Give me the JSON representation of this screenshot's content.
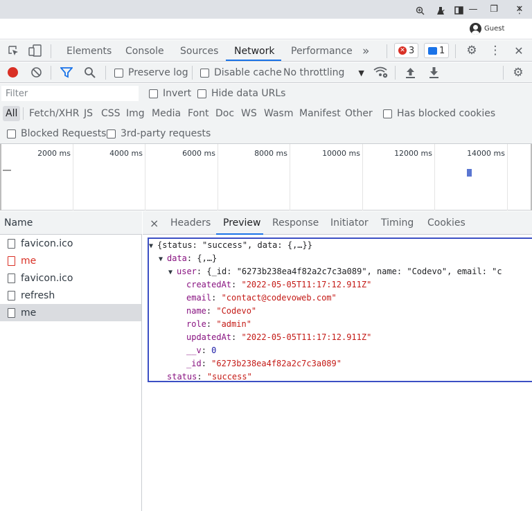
{
  "browser": {
    "profile_label": "Guest"
  },
  "devtools": {
    "tabs": [
      "Elements",
      "Console",
      "Sources",
      "Network",
      "Performance"
    ],
    "more_tabs": "»",
    "error_count": "3",
    "message_count": "1"
  },
  "network_toolbar": {
    "preserve_log": "Preserve log",
    "disable_cache": "Disable cache",
    "throttling": "No throttling"
  },
  "filter": {
    "placeholder": "Filter",
    "invert": "Invert",
    "hide_data_urls": "Hide data URLs",
    "types": [
      "All",
      "Fetch/XHR",
      "JS",
      "CSS",
      "Img",
      "Media",
      "Font",
      "Doc",
      "WS",
      "Wasm",
      "Manifest",
      "Other"
    ],
    "has_blocked_cookies": "Has blocked cookies",
    "blocked_requests": "Blocked Requests",
    "third_party": "3rd-party requests"
  },
  "timeline": {
    "ticks": [
      "2000 ms",
      "4000 ms",
      "6000 ms",
      "8000 ms",
      "10000 ms",
      "12000 ms",
      "14000 ms"
    ]
  },
  "requests": {
    "header": "Name",
    "rows": [
      {
        "name": "favicon.ico",
        "status": "ok"
      },
      {
        "name": "me",
        "status": "error"
      },
      {
        "name": "favicon.ico",
        "status": "ok"
      },
      {
        "name": "refresh",
        "status": "ok"
      },
      {
        "name": "me",
        "status": "selected"
      }
    ]
  },
  "details": {
    "close": "×",
    "tabs": [
      "Headers",
      "Preview",
      "Response",
      "Initiator",
      "Timing",
      "Cookies"
    ],
    "active_tab": "Preview"
  },
  "preview": {
    "root_summary": "{status: \"success\", data: {,…}}",
    "data_key": "data",
    "data_summary": "{,…}",
    "user_key": "user",
    "user_summary": "{_id: \"6273b238ea4f82a2c7c3a089\", name: \"Codevo\", email: \"c",
    "fields": [
      {
        "key": "createdAt",
        "value": "\"2022-05-05T11:17:12.911Z\"",
        "type": "string"
      },
      {
        "key": "email",
        "value": "\"contact@codevoweb.com\"",
        "type": "string"
      },
      {
        "key": "name",
        "value": "\"Codevo\"",
        "type": "string"
      },
      {
        "key": "role",
        "value": "\"admin\"",
        "type": "string"
      },
      {
        "key": "updatedAt",
        "value": "\"2022-05-05T11:17:12.911Z\"",
        "type": "string"
      },
      {
        "key": "__v",
        "value": "0",
        "type": "number"
      },
      {
        "key": "_id",
        "value": "\"6273b238ea4f82a2c7c3a089\"",
        "type": "string"
      }
    ],
    "status_key": "status",
    "status_value": "\"success\""
  },
  "colors": {
    "accent": "#1a73e8",
    "record": "#d93025",
    "preview_border": "#3b4fc4"
  }
}
